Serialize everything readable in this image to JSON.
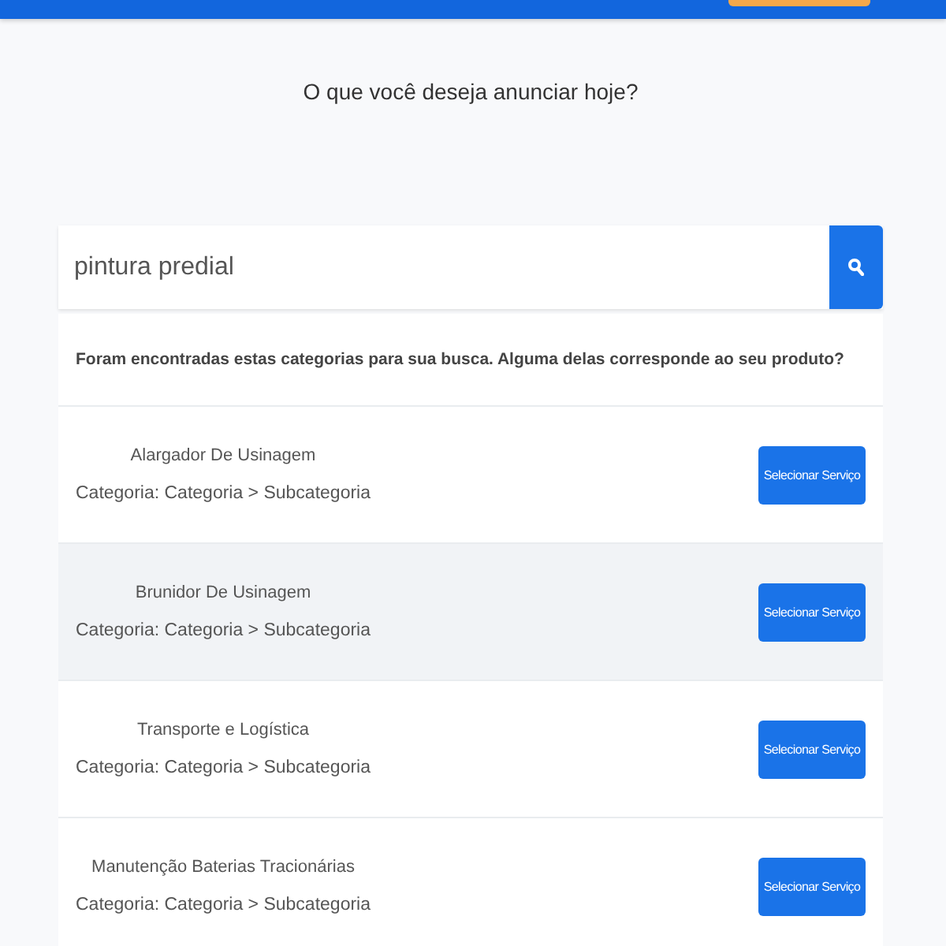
{
  "heading": "O que você deseja anunciar hoje?",
  "search": {
    "value": "pintura predial"
  },
  "results": {
    "message": "Foram encontradas estas categorias para sua busca. Alguma delas corresponde ao seu produto?",
    "items": [
      {
        "title": "Alargador De Usinagem",
        "category": "Categoria: Categoria > Subcategoria",
        "button": "Selecionar Serviço",
        "highlighted": false
      },
      {
        "title": "Brunidor De Usinagem",
        "category": "Categoria: Categoria > Subcategoria",
        "button": "Selecionar Serviço",
        "highlighted": true
      },
      {
        "title": "Transporte e Logística",
        "category": "Categoria: Categoria > Subcategoria",
        "button": "Selecionar Serviço",
        "highlighted": false
      },
      {
        "title": "Manutenção Baterias Tracionárias",
        "category": "Categoria: Categoria > Subcategoria",
        "button": "Selecionar Serviço",
        "highlighted": false
      }
    ]
  }
}
